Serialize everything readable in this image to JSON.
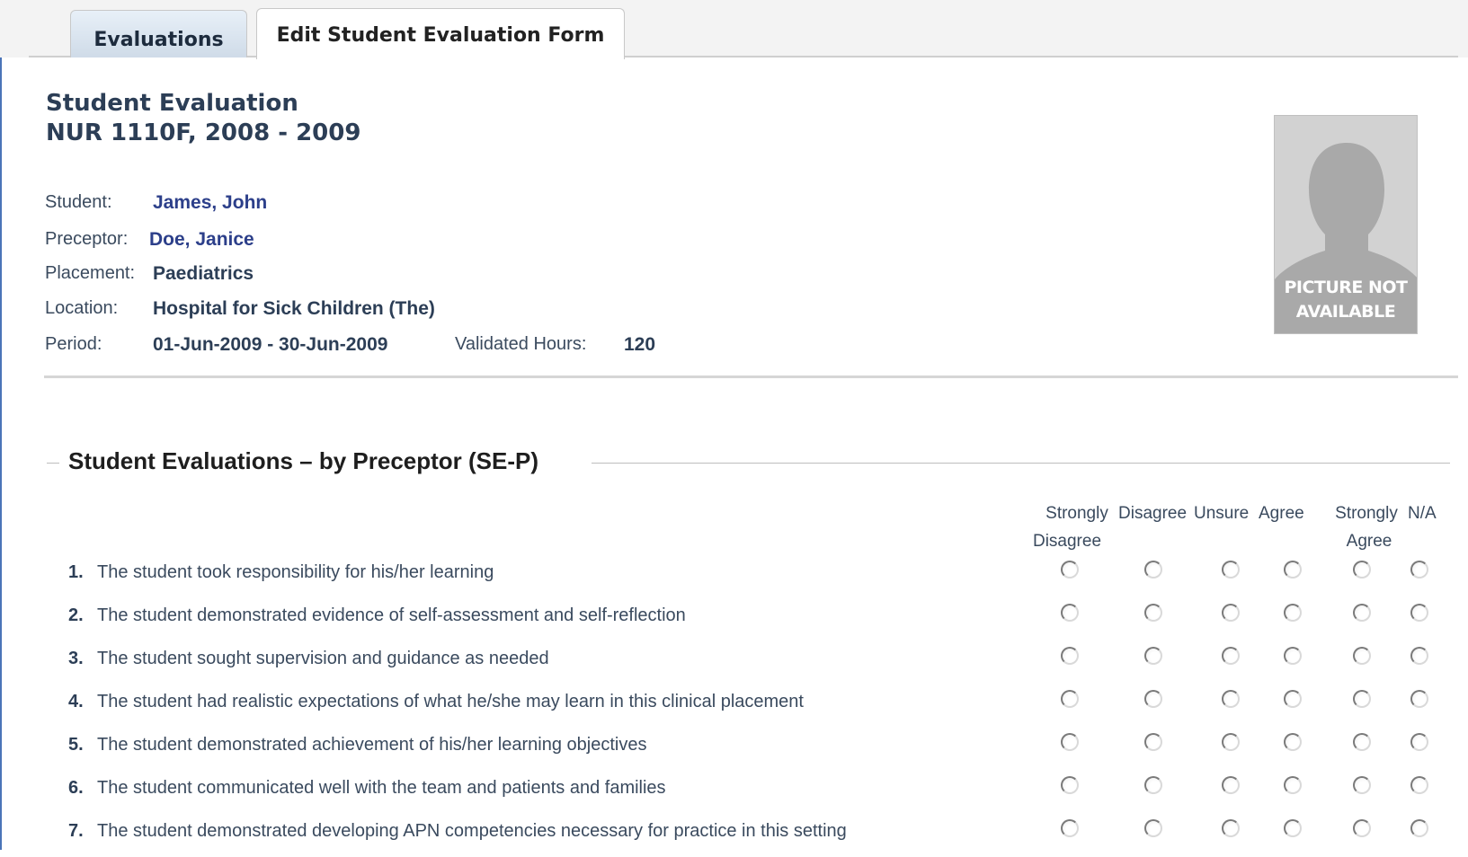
{
  "tabs": [
    {
      "label": "Evaluations"
    },
    {
      "label": "Edit Student Evaluation Form"
    }
  ],
  "header": {
    "title": "Student Evaluation",
    "course": "NUR 1110F, 2008 - 2009"
  },
  "info": {
    "student_label": "Student:",
    "student_value": "James, John",
    "preceptor_label": "Preceptor:",
    "preceptor_value": "Doe, Janice",
    "placement_label": "Placement:",
    "placement_value": "Paediatrics",
    "location_label": "Location:",
    "location_value": "Hospital for Sick Children (The)",
    "period_label": "Period:",
    "period_value": "01-Jun-2009 - 30-Jun-2009",
    "hours_label": "Validated Hours:",
    "hours_value": "120"
  },
  "photo": {
    "line1": "PICTURE NOT",
    "line2": "AVAILABLE"
  },
  "section": {
    "title": "Student Evaluations – by Preceptor (SE-P)"
  },
  "scale": {
    "strongly_disagree_1": "Strongly",
    "strongly_disagree_2": "Disagree",
    "disagree": "Disagree",
    "unsure": "Unsure",
    "agree": "Agree",
    "strongly_agree_1": "Strongly",
    "strongly_agree_2": "Agree",
    "na": "N/A"
  },
  "questions": [
    {
      "num": "1.",
      "text": "The student took responsibility for his/her learning"
    },
    {
      "num": "2.",
      "text": "The student demonstrated evidence of self-assessment and self-reflection"
    },
    {
      "num": "3.",
      "text": "The student sought supervision and guidance as needed"
    },
    {
      "num": "4.",
      "text": "The student had realistic expectations of what he/she may learn in this clinical placement"
    },
    {
      "num": "5.",
      "text": "The student demonstrated achievement of his/her learning objectives"
    },
    {
      "num": "6.",
      "text": "The student communicated well with the team and patients and families"
    },
    {
      "num": "7.",
      "text": "The student demonstrated developing APN competencies necessary for practice in this setting"
    }
  ]
}
